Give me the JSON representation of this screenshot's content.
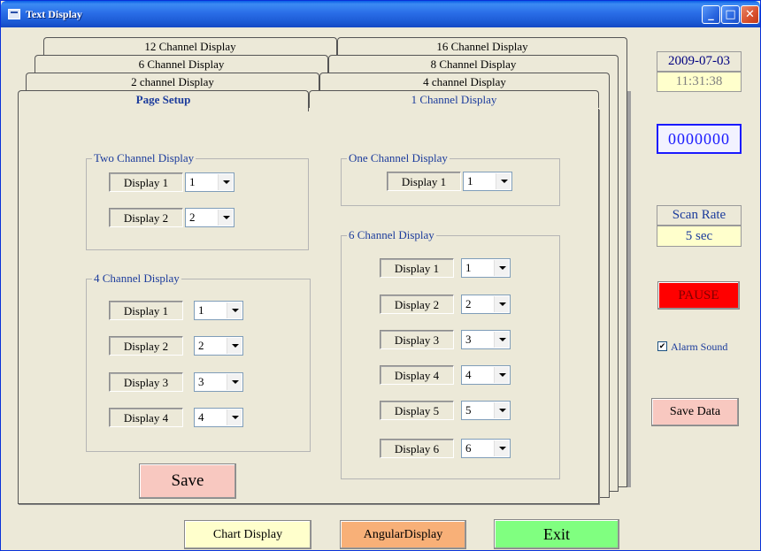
{
  "window": {
    "title": "Text Display"
  },
  "titlebar_buttons": {
    "minimize": "_",
    "maximize": "□",
    "close": "✕"
  },
  "tabs": {
    "row1": [
      "12 Channel Display",
      "16 Channel Display"
    ],
    "row2": [
      "6 Channel Display",
      "8 Channel Display"
    ],
    "row3": [
      "2 channel Display",
      "4 channel Display"
    ],
    "row4": [
      "Page Setup",
      "1 Channel Display"
    ]
  },
  "groups": {
    "two": {
      "title": "Two Channel Display",
      "rows": [
        {
          "label": "Display 1",
          "value": "1"
        },
        {
          "label": "Display 2",
          "value": "2"
        }
      ]
    },
    "four": {
      "title": "4 Channel Display",
      "rows": [
        {
          "label": "Display 1",
          "value": "1"
        },
        {
          "label": "Display 2",
          "value": "2"
        },
        {
          "label": "Display 3",
          "value": "3"
        },
        {
          "label": "Display 4",
          "value": "4"
        }
      ]
    },
    "one": {
      "title": "One Channel Display",
      "rows": [
        {
          "label": "Display 1",
          "value": "1"
        }
      ]
    },
    "six": {
      "title": "6 Channel Display",
      "rows": [
        {
          "label": "Display 1",
          "value": "1"
        },
        {
          "label": "Display 2",
          "value": "2"
        },
        {
          "label": "Display 3",
          "value": "3"
        },
        {
          "label": "Display 4",
          "value": "4"
        },
        {
          "label": "Display 5",
          "value": "5"
        },
        {
          "label": "Display 6",
          "value": "6"
        }
      ]
    }
  },
  "save_button": "Save",
  "side": {
    "date": "2009-07-03",
    "time": "11:31:38",
    "counter": "0000000",
    "scan_rate_label": "Scan Rate",
    "scan_rate_value": "5 sec",
    "pause": "PAUSE",
    "alarm_sound": "Alarm Sound",
    "save_data": "Save Data"
  },
  "bottom": {
    "chart": "Chart Display",
    "angular": "AngularDisplay",
    "exit": "Exit"
  },
  "colors": {
    "save": "#f8c8c0",
    "pause": "#ff0000",
    "chart": "#ffffcc",
    "angular": "#f8b078",
    "exit": "#80ff80",
    "date_bg": "#ffffcc",
    "counter_fg": "#1a1aff"
  }
}
